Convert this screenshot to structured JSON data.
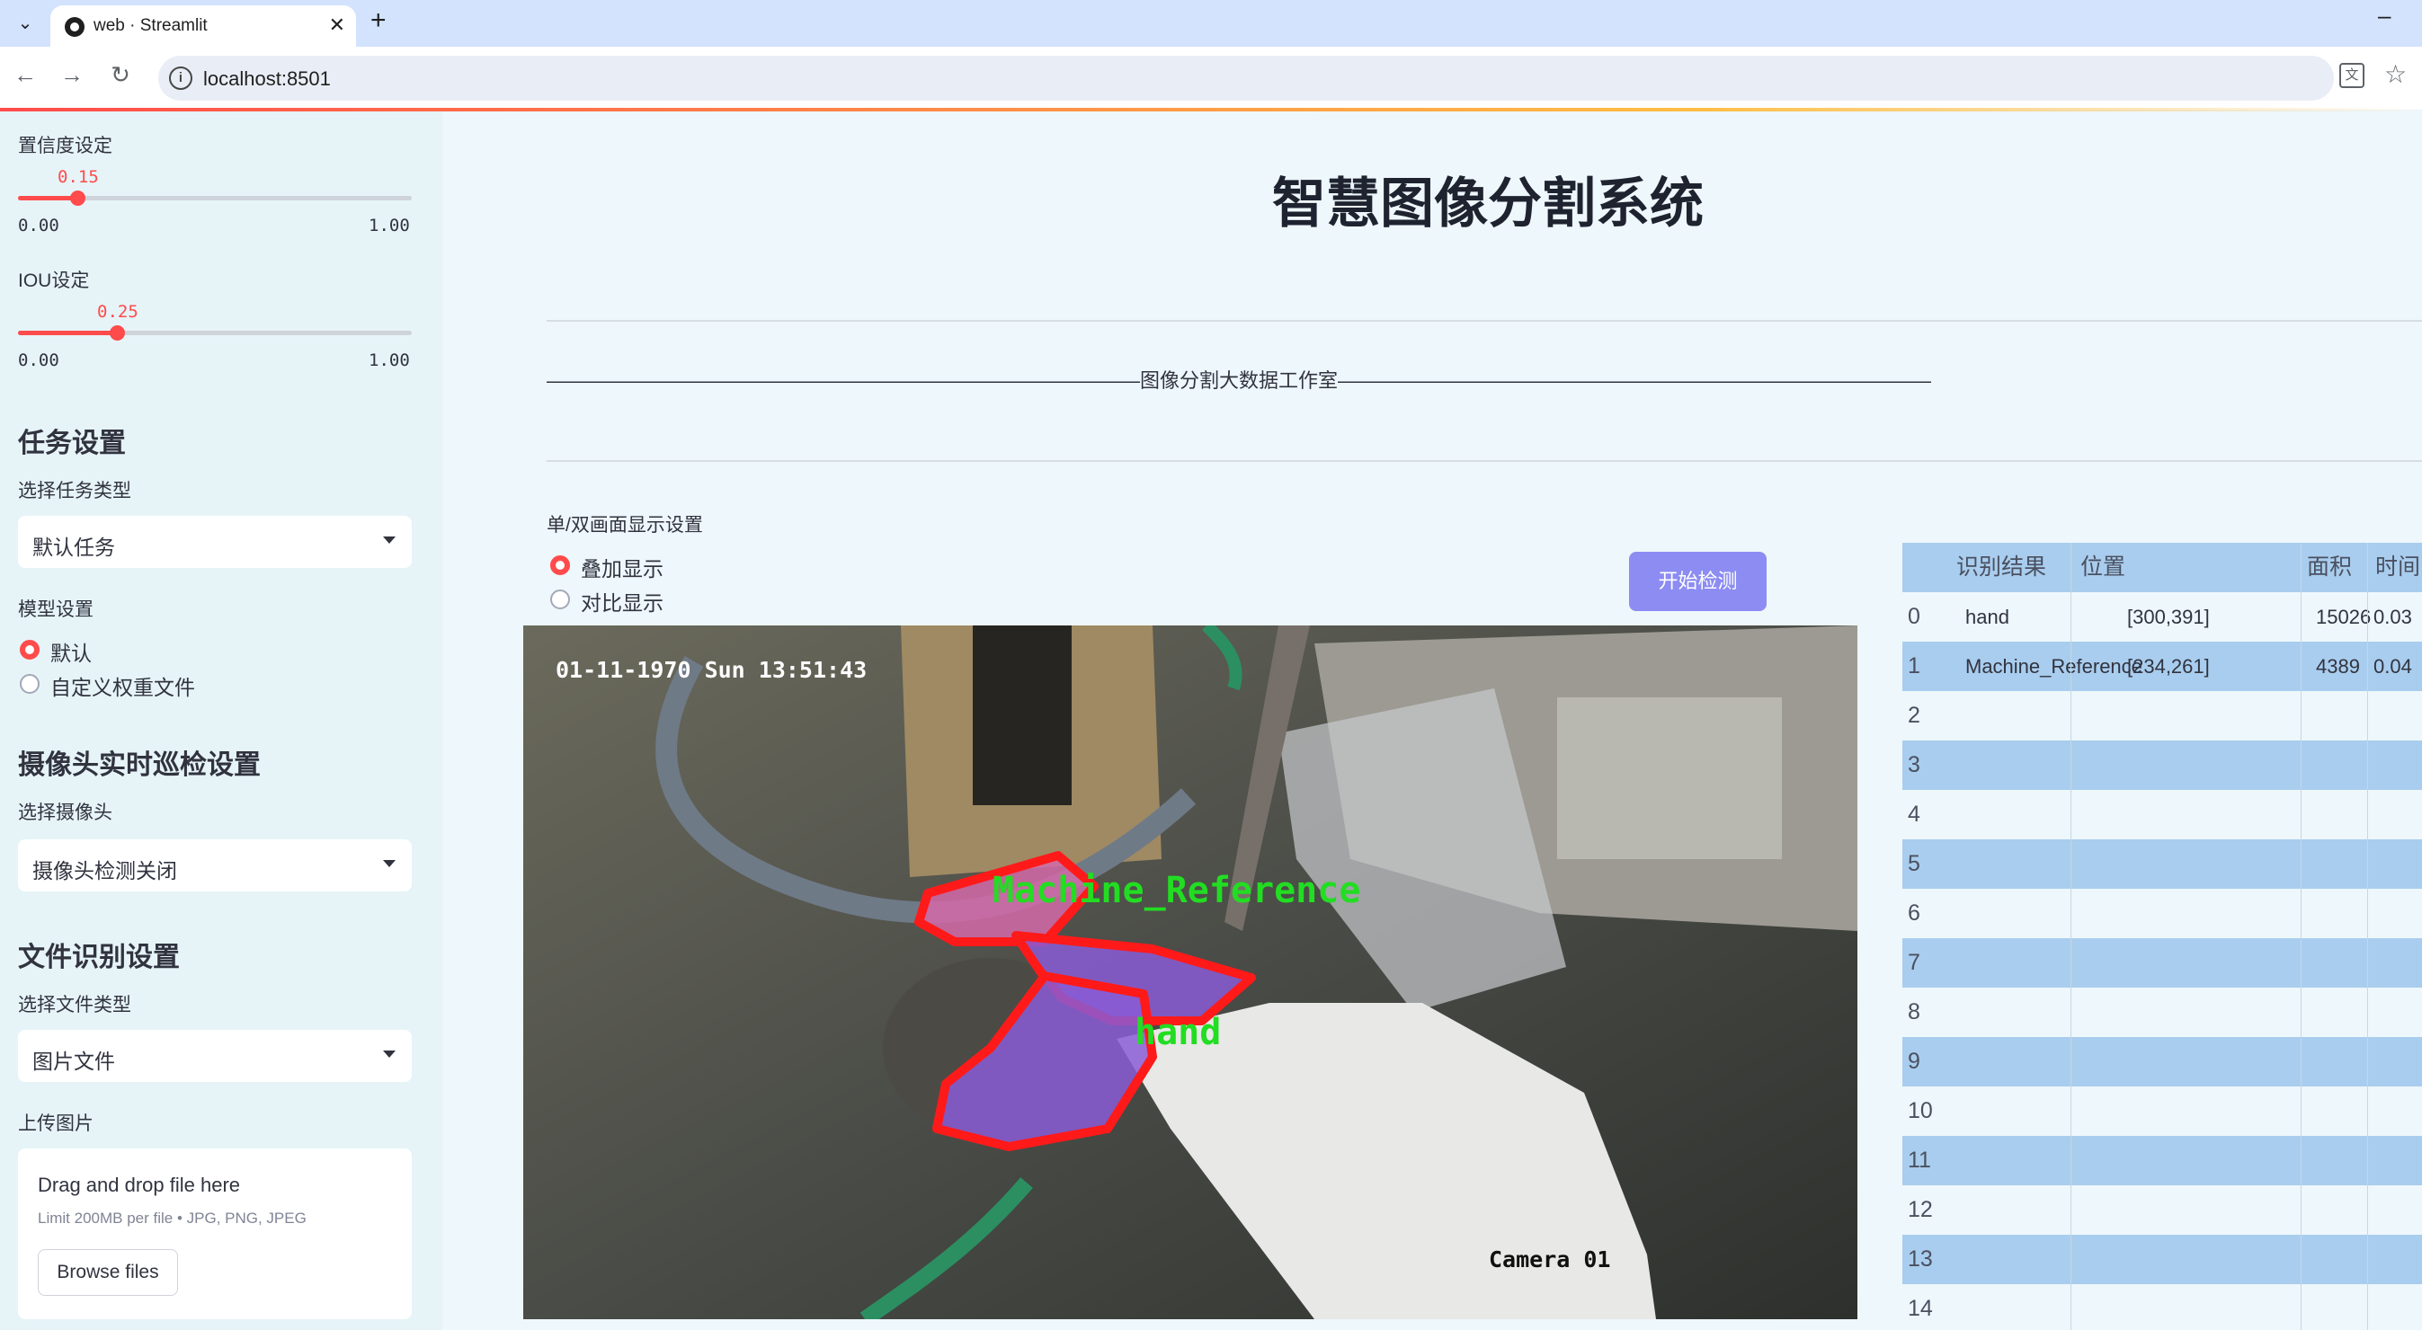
{
  "browser": {
    "tab_title": "web · Streamlit",
    "url": "localhost:8501"
  },
  "sidebar": {
    "confidence": {
      "label": "置信度设定",
      "value": "0.15",
      "min": "0.00",
      "max": "1.00",
      "fraction": 0.15
    },
    "iou": {
      "label": "IOU设定",
      "value": "0.25",
      "min": "0.00",
      "max": "1.00",
      "fraction": 0.25
    },
    "task_heading": "任务设置",
    "task_type_label": "选择任务类型",
    "task_type_value": "默认任务",
    "model_label": "模型设置",
    "model_options": [
      "默认",
      "自定义权重文件"
    ],
    "model_selected": "默认",
    "camera_heading": "摄像头实时巡检设置",
    "camera_label": "选择摄像头",
    "camera_value": "摄像头检测关闭",
    "file_heading": "文件识别设置",
    "file_type_label": "选择文件类型",
    "file_type_value": "图片文件",
    "upload_label": "上传图片",
    "upload": {
      "title": "Drag and drop file here",
      "limit": "Limit 200MB per file • JPG, PNG, JPEG",
      "button": "Browse files"
    }
  },
  "main": {
    "title": "智慧图像分割系统",
    "banner": "——————————————————————————————图像分割大数据工作室——————————————————————————————",
    "display_mode_label": "单/双画面显示设置",
    "display_modes": [
      "叠加显示",
      "对比显示"
    ],
    "display_mode_selected": "叠加显示",
    "start_button": "开始检测",
    "image": {
      "timestamp": "01-11-1970 Sun 13:51:43",
      "camera_label": "Camera 01",
      "detections": [
        "Machine_Reference",
        "hand"
      ],
      "colors": {
        "hand_fill": "#8a5cd6",
        "machine_fill": "#d46aa8",
        "outline": "#ff1a1a",
        "label_text": "#22dd22"
      }
    }
  },
  "results_table": {
    "columns": [
      "识别结果",
      "位置",
      "面积",
      "时间"
    ],
    "rows": [
      {
        "index": "0",
        "result": "hand",
        "position": "[300,391]",
        "area": "15026",
        "time": "0.03"
      },
      {
        "index": "1",
        "result": "Machine_Reference",
        "position": "[234,261]",
        "area": "4389",
        "time": "0.04"
      },
      {
        "index": "2"
      },
      {
        "index": "3"
      },
      {
        "index": "4"
      },
      {
        "index": "5"
      },
      {
        "index": "6"
      },
      {
        "index": "7"
      },
      {
        "index": "8"
      },
      {
        "index": "9"
      },
      {
        "index": "10"
      },
      {
        "index": "11"
      },
      {
        "index": "12"
      },
      {
        "index": "13"
      },
      {
        "index": "14"
      }
    ]
  }
}
